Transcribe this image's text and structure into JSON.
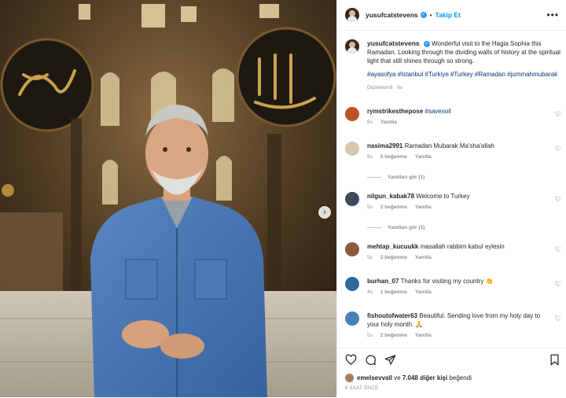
{
  "post": {
    "username": "yusufcatstevens",
    "verified_mark": "✓",
    "separator": "•",
    "follow_label": "Takip Et",
    "more_icon": "•••",
    "caption": "Wonderful visit to the Hagia Sophia this Ramadan. Looking through the dividing walls of history at the spiritual light that still shines through so strong.",
    "hashtags": "#ayasofya #Istanbul #Turkiye #Turkey #Ramadan #jummahmubarak",
    "edited": "Düzenlendi · 6s",
    "next_icon": "›"
  },
  "comments": [
    {
      "user": "rymstrikesthepose",
      "text": "",
      "tag": "#savesoil",
      "time": "6s",
      "likes": "",
      "reply": "Yanıtla",
      "view_replies": "",
      "avatar_color": "#c0502a"
    },
    {
      "user": "nasima2991",
      "text": "Ramadan Mubarak Ma'sha'allah",
      "tag": "",
      "time": "6s",
      "likes": "5 beğenme",
      "reply": "Yanıtla",
      "view_replies": "Yanıtları gör (1)",
      "avatar_color": "#d8c6b0"
    },
    {
      "user": "nilgun_kabak78",
      "text": "Welcome to Turkey",
      "tag": "",
      "time": "5s",
      "likes": "2 beğenme",
      "reply": "Yanıtla",
      "view_replies": "Yanıtları gör (1)",
      "avatar_color": "#3d4a5e"
    },
    {
      "user": "mehtap_kucuukk",
      "text": "masallah rabbim kabul eylesin",
      "tag": "",
      "time": "5s",
      "likes": "2 beğenme",
      "reply": "Yanıtla",
      "view_replies": "",
      "avatar_color": "#8a5a3a"
    },
    {
      "user": "burhan_07",
      "text": "Thanks for visiting my country 👏",
      "tag": "",
      "time": "4s",
      "likes": "1 beğenme",
      "reply": "Yanıtla",
      "view_replies": "",
      "avatar_color": "#2f6b9a"
    },
    {
      "user": "fishoutofwater63",
      "text": "Beautiful. Sending love from my holy day to your holy month. 🙏",
      "tag": "",
      "time": "5s",
      "likes": "2 beğenme",
      "reply": "Yanıtla",
      "view_replies": "",
      "avatar_color": "#4a7fb5"
    }
  ],
  "footer": {
    "liked_by_user": "emelsevvall",
    "liked_mid": " ve ",
    "liked_count": "7.048 diğer kişi",
    "liked_end": " beğendi",
    "time": "6 SAAT ÖNCE"
  },
  "icons": {
    "heart": "heart-icon",
    "comment": "comment-icon",
    "share": "share-icon",
    "save": "bookmark-icon"
  },
  "colors": {
    "link": "#00376b",
    "follow": "#0095f6",
    "meta": "#8e8e8e"
  }
}
